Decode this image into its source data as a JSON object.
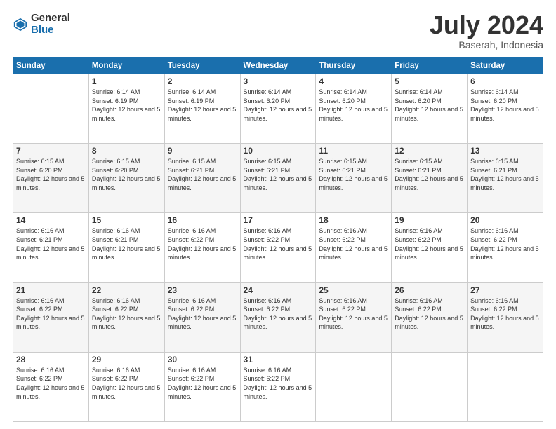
{
  "logo": {
    "general": "General",
    "blue": "Blue"
  },
  "title": "July 2024",
  "location": "Baserah, Indonesia",
  "days": [
    "Sunday",
    "Monday",
    "Tuesday",
    "Wednesday",
    "Thursday",
    "Friday",
    "Saturday"
  ],
  "weeks": [
    [
      {
        "day": "",
        "sunrise": "",
        "sunset": "",
        "daylight": ""
      },
      {
        "day": "1",
        "sunrise": "Sunrise: 6:14 AM",
        "sunset": "Sunset: 6:19 PM",
        "daylight": "Daylight: 12 hours and 5 minutes."
      },
      {
        "day": "2",
        "sunrise": "Sunrise: 6:14 AM",
        "sunset": "Sunset: 6:19 PM",
        "daylight": "Daylight: 12 hours and 5 minutes."
      },
      {
        "day": "3",
        "sunrise": "Sunrise: 6:14 AM",
        "sunset": "Sunset: 6:20 PM",
        "daylight": "Daylight: 12 hours and 5 minutes."
      },
      {
        "day": "4",
        "sunrise": "Sunrise: 6:14 AM",
        "sunset": "Sunset: 6:20 PM",
        "daylight": "Daylight: 12 hours and 5 minutes."
      },
      {
        "day": "5",
        "sunrise": "Sunrise: 6:14 AM",
        "sunset": "Sunset: 6:20 PM",
        "daylight": "Daylight: 12 hours and 5 minutes."
      },
      {
        "day": "6",
        "sunrise": "Sunrise: 6:14 AM",
        "sunset": "Sunset: 6:20 PM",
        "daylight": "Daylight: 12 hours and 5 minutes."
      }
    ],
    [
      {
        "day": "7",
        "sunrise": "Sunrise: 6:15 AM",
        "sunset": "Sunset: 6:20 PM",
        "daylight": "Daylight: 12 hours and 5 minutes."
      },
      {
        "day": "8",
        "sunrise": "Sunrise: 6:15 AM",
        "sunset": "Sunset: 6:20 PM",
        "daylight": "Daylight: 12 hours and 5 minutes."
      },
      {
        "day": "9",
        "sunrise": "Sunrise: 6:15 AM",
        "sunset": "Sunset: 6:21 PM",
        "daylight": "Daylight: 12 hours and 5 minutes."
      },
      {
        "day": "10",
        "sunrise": "Sunrise: 6:15 AM",
        "sunset": "Sunset: 6:21 PM",
        "daylight": "Daylight: 12 hours and 5 minutes."
      },
      {
        "day": "11",
        "sunrise": "Sunrise: 6:15 AM",
        "sunset": "Sunset: 6:21 PM",
        "daylight": "Daylight: 12 hours and 5 minutes."
      },
      {
        "day": "12",
        "sunrise": "Sunrise: 6:15 AM",
        "sunset": "Sunset: 6:21 PM",
        "daylight": "Daylight: 12 hours and 5 minutes."
      },
      {
        "day": "13",
        "sunrise": "Sunrise: 6:15 AM",
        "sunset": "Sunset: 6:21 PM",
        "daylight": "Daylight: 12 hours and 5 minutes."
      }
    ],
    [
      {
        "day": "14",
        "sunrise": "Sunrise: 6:16 AM",
        "sunset": "Sunset: 6:21 PM",
        "daylight": "Daylight: 12 hours and 5 minutes."
      },
      {
        "day": "15",
        "sunrise": "Sunrise: 6:16 AM",
        "sunset": "Sunset: 6:21 PM",
        "daylight": "Daylight: 12 hours and 5 minutes."
      },
      {
        "day": "16",
        "sunrise": "Sunrise: 6:16 AM",
        "sunset": "Sunset: 6:22 PM",
        "daylight": "Daylight: 12 hours and 5 minutes."
      },
      {
        "day": "17",
        "sunrise": "Sunrise: 6:16 AM",
        "sunset": "Sunset: 6:22 PM",
        "daylight": "Daylight: 12 hours and 5 minutes."
      },
      {
        "day": "18",
        "sunrise": "Sunrise: 6:16 AM",
        "sunset": "Sunset: 6:22 PM",
        "daylight": "Daylight: 12 hours and 5 minutes."
      },
      {
        "day": "19",
        "sunrise": "Sunrise: 6:16 AM",
        "sunset": "Sunset: 6:22 PM",
        "daylight": "Daylight: 12 hours and 5 minutes."
      },
      {
        "day": "20",
        "sunrise": "Sunrise: 6:16 AM",
        "sunset": "Sunset: 6:22 PM",
        "daylight": "Daylight: 12 hours and 5 minutes."
      }
    ],
    [
      {
        "day": "21",
        "sunrise": "Sunrise: 6:16 AM",
        "sunset": "Sunset: 6:22 PM",
        "daylight": "Daylight: 12 hours and 5 minutes."
      },
      {
        "day": "22",
        "sunrise": "Sunrise: 6:16 AM",
        "sunset": "Sunset: 6:22 PM",
        "daylight": "Daylight: 12 hours and 5 minutes."
      },
      {
        "day": "23",
        "sunrise": "Sunrise: 6:16 AM",
        "sunset": "Sunset: 6:22 PM",
        "daylight": "Daylight: 12 hours and 5 minutes."
      },
      {
        "day": "24",
        "sunrise": "Sunrise: 6:16 AM",
        "sunset": "Sunset: 6:22 PM",
        "daylight": "Daylight: 12 hours and 5 minutes."
      },
      {
        "day": "25",
        "sunrise": "Sunrise: 6:16 AM",
        "sunset": "Sunset: 6:22 PM",
        "daylight": "Daylight: 12 hours and 5 minutes."
      },
      {
        "day": "26",
        "sunrise": "Sunrise: 6:16 AM",
        "sunset": "Sunset: 6:22 PM",
        "daylight": "Daylight: 12 hours and 5 minutes."
      },
      {
        "day": "27",
        "sunrise": "Sunrise: 6:16 AM",
        "sunset": "Sunset: 6:22 PM",
        "daylight": "Daylight: 12 hours and 5 minutes."
      }
    ],
    [
      {
        "day": "28",
        "sunrise": "Sunrise: 6:16 AM",
        "sunset": "Sunset: 6:22 PM",
        "daylight": "Daylight: 12 hours and 5 minutes."
      },
      {
        "day": "29",
        "sunrise": "Sunrise: 6:16 AM",
        "sunset": "Sunset: 6:22 PM",
        "daylight": "Daylight: 12 hours and 5 minutes."
      },
      {
        "day": "30",
        "sunrise": "Sunrise: 6:16 AM",
        "sunset": "Sunset: 6:22 PM",
        "daylight": "Daylight: 12 hours and 5 minutes."
      },
      {
        "day": "31",
        "sunrise": "Sunrise: 6:16 AM",
        "sunset": "Sunset: 6:22 PM",
        "daylight": "Daylight: 12 hours and 5 minutes."
      },
      {
        "day": "",
        "sunrise": "",
        "sunset": "",
        "daylight": ""
      },
      {
        "day": "",
        "sunrise": "",
        "sunset": "",
        "daylight": ""
      },
      {
        "day": "",
        "sunrise": "",
        "sunset": "",
        "daylight": ""
      }
    ]
  ]
}
